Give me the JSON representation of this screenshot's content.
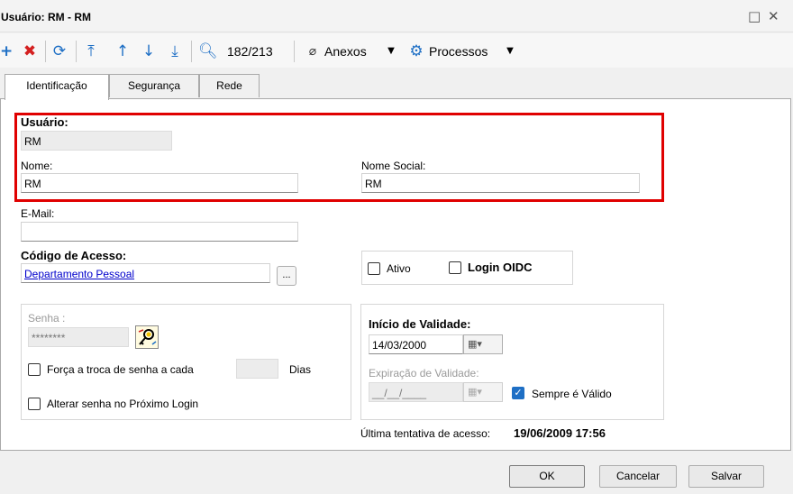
{
  "window": {
    "title": "Usuário: RM - RM",
    "restore_glyph": "□",
    "close_glyph": "✕"
  },
  "toolbar": {
    "record_counter": "182/213",
    "anexos_label": "Anexos",
    "processos_label": "Processos",
    "icons": [
      "plus-icon",
      "delete-icon",
      "refresh-icon",
      "first-icon",
      "previous-icon",
      "next-icon",
      "last-icon",
      "search-icon",
      "paperclip-icon",
      "gear-icon"
    ]
  },
  "tabs": [
    {
      "label": "Identificação",
      "active": true
    },
    {
      "label": "Segurança",
      "active": false
    },
    {
      "label": "Rede",
      "active": false
    }
  ],
  "form": {
    "usuario_label": "Usuário:",
    "usuario_value": "RM",
    "nome_label": "Nome:",
    "nome_value": "RM",
    "nome_social_label": "Nome Social:",
    "nome_social_value": "RM",
    "email_label": "E-Mail:",
    "email_value": "",
    "codigo_acesso_label": "Código de Acesso:",
    "codigo_acesso_value": "Departamento Pessoal",
    "lookup_button": "...",
    "ativo_label": "Ativo",
    "ativo_checked": false,
    "login_oidc_label": "Login OIDC",
    "login_oidc_checked": false
  },
  "password": {
    "senha_label": "Senha :",
    "senha_value": "********",
    "forca_troca_label": "Força a troca de senha a cada",
    "forca_troca_checked": false,
    "dias_value": "",
    "dias_label": "Dias",
    "alterar_senha_label": "Alterar senha no Próximo Login",
    "alterar_senha_checked": false
  },
  "validity": {
    "inicio_label": "Início de Validade:",
    "inicio_value": "14/03/2000",
    "expiracao_label": "Expiração de Validade:",
    "expiracao_value": "__/__/____",
    "sempre_valido_label": "Sempre é Válido",
    "sempre_valido_checked": true
  },
  "last_access": {
    "label": "Última tentativa de acesso:",
    "value": "19/06/2009 17:56"
  },
  "buttons": {
    "ok": "OK",
    "cancelar": "Cancelar",
    "salvar": "Salvar"
  },
  "colors": {
    "highlight_border": "#e00000",
    "accent_blue": "#1e6fc5",
    "delete_red": "#d42020",
    "link_blue": "#0000cc"
  }
}
